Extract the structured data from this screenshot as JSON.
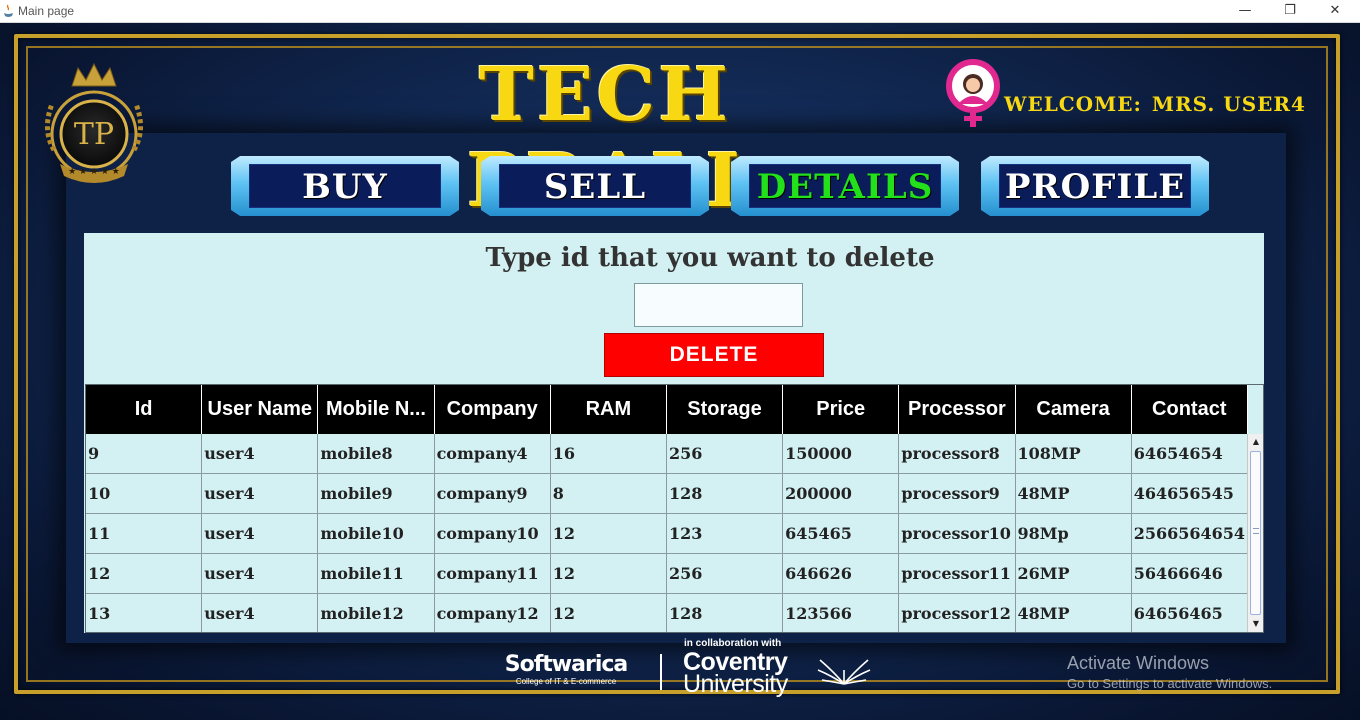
{
  "window": {
    "title": "Main page",
    "minimize_glyph": "—",
    "maximize_glyph": "❐",
    "close_glyph": "✕"
  },
  "logo": {
    "monogram": "TP"
  },
  "header": {
    "brand": "TECH PRALI",
    "welcome_label": "WELCOME:",
    "welcome_user": "MRS. USER4"
  },
  "nav": [
    {
      "label": "BUY",
      "active": false
    },
    {
      "label": "SELL",
      "active": false
    },
    {
      "label": "DETAILS",
      "active": true
    },
    {
      "label": "PROFILE",
      "active": false
    }
  ],
  "delete_form": {
    "prompt": "Type id that you want to delete",
    "input_value": "",
    "button_label": "DELETE"
  },
  "table": {
    "columns": [
      "Id",
      "User Name",
      "Mobile N...",
      "Company",
      "RAM",
      "Storage",
      "Price",
      "Processor",
      "Camera",
      "Contact"
    ],
    "rows": [
      [
        "9",
        "user4",
        "mobile8",
        "company4",
        "16",
        "256",
        "150000",
        "processor8",
        "108MP",
        "64654654"
      ],
      [
        "10",
        "user4",
        "mobile9",
        "company9",
        "8",
        "128",
        "200000",
        "processor9",
        "48MP",
        "464656545"
      ],
      [
        "11",
        "user4",
        "mobile10",
        "company10",
        "12",
        "123",
        "645465",
        "processor10",
        "98Mp",
        "2566564654"
      ],
      [
        "12",
        "user4",
        "mobile11",
        "company11",
        "12",
        "256",
        "646626",
        "processor11",
        "26MP",
        "56466646"
      ],
      [
        "13",
        "user4",
        "mobile12",
        "company12",
        "12",
        "128",
        "123566",
        "processor12",
        "48MP",
        "64656465"
      ]
    ]
  },
  "footer": {
    "collab_text": "in collaboration with",
    "softwarica_name": "Softwarica",
    "softwarica_sub": "College of IT & E-commerce",
    "coventry_line1": "Coventry",
    "coventry_line2": "University"
  },
  "watermark": {
    "line1": "Activate Windows",
    "line2": "Go to Settings to activate Windows."
  },
  "colors": {
    "brand_yellow": "#f7d813",
    "active_nav": "#22e01a",
    "delete_red": "#ff0000",
    "panel_bg": "#d3f0f3",
    "gold_border": "#c7a02c"
  }
}
